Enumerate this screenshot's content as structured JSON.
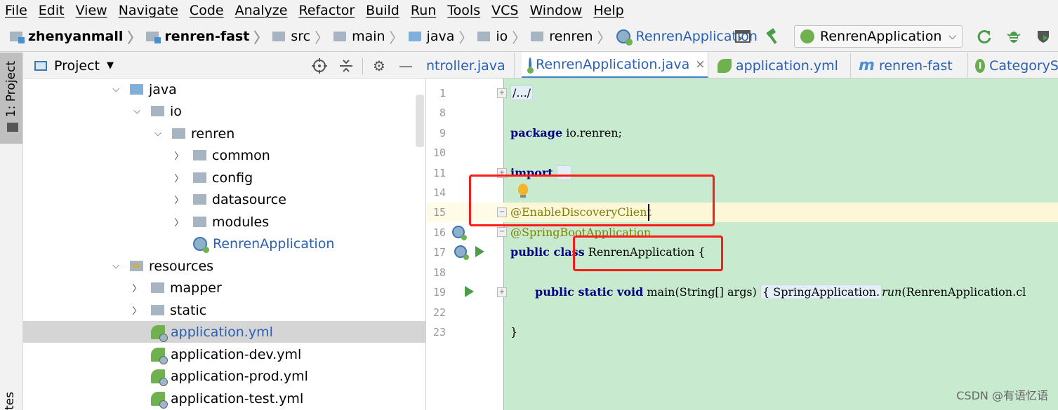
{
  "menu": [
    "File",
    "Edit",
    "View",
    "Navigate",
    "Code",
    "Analyze",
    "Refactor",
    "Build",
    "Run",
    "Tools",
    "VCS",
    "Window",
    "Help"
  ],
  "breadcrumb": [
    "zhenyanmall",
    "renren-fast",
    "src",
    "main",
    "java",
    "io",
    "renren",
    "RenrenApplication"
  ],
  "run_config": "RenrenApplication",
  "left_strip": {
    "project_tab": "1: Project",
    "favorites_tab": "tes"
  },
  "project_panel": {
    "title": "Project",
    "tree": [
      {
        "label": "java"
      },
      {
        "label": "io"
      },
      {
        "label": "renren"
      },
      {
        "label": "common"
      },
      {
        "label": "config"
      },
      {
        "label": "datasource"
      },
      {
        "label": "modules"
      },
      {
        "label": "RenrenApplication"
      },
      {
        "label": "resources"
      },
      {
        "label": "mapper"
      },
      {
        "label": "static"
      },
      {
        "label": "application.yml"
      },
      {
        "label": "application-dev.yml"
      },
      {
        "label": "application-prod.yml"
      },
      {
        "label": "application-test.yml"
      }
    ]
  },
  "tabs": [
    "ntroller.java",
    "RenrenApplication.java",
    "application.yml",
    "renren-fast",
    "CategoryS"
  ],
  "tab_close": "×",
  "editor": {
    "line_numbers": [
      "1",
      "8",
      "9",
      "10",
      "11",
      "14",
      "15",
      "16",
      "17",
      "18",
      "19",
      "22",
      "23"
    ],
    "code": {
      "l1": "/.../",
      "l9_kw": "package",
      "l9_rest": " io.renren;",
      "l11_kw": "import",
      "l11_ph": "...",
      "l15": "@EnableDiscoveryClient",
      "l16": "@SpringBootApplication",
      "l17_kw": "public class",
      "l17_rest": " RenrenApplication {",
      "l19_kw": "public static void",
      "l19_a": " main(String[] args) ",
      "l19_b": "{ SpringApplication.",
      "l19_run": "run",
      "l19_c": "(RenrenApplication.cl",
      "l23": "}"
    }
  },
  "watermark": "CSDN @有语忆语",
  "colors": {
    "accent": "#4083c9",
    "annotation_red": "#ff1a1a",
    "code_bg": "#c8ebcf"
  }
}
